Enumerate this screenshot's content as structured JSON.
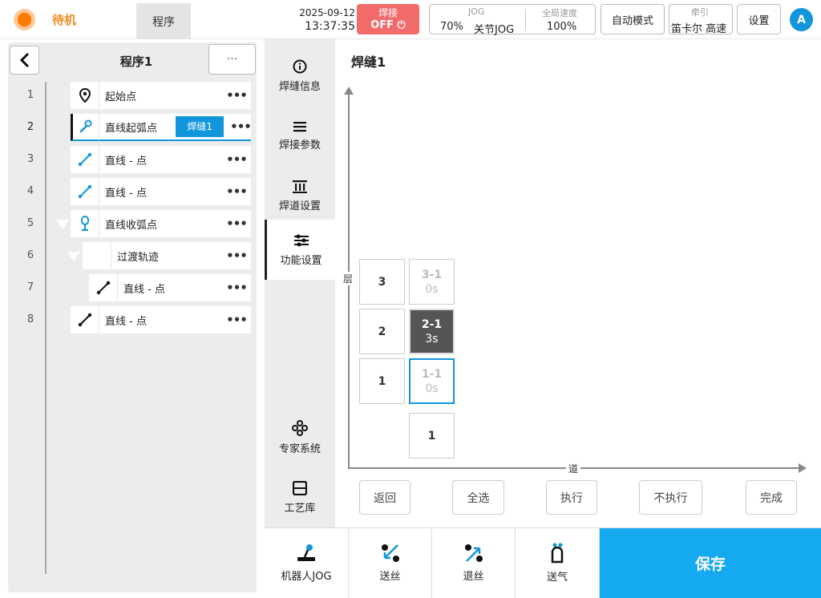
{
  "header": {
    "status": "待机",
    "program_tab": "程序",
    "date": "2025-09-12",
    "time": "13:37:35",
    "weld_label": "焊接",
    "weld_state": "OFF",
    "jog_title": "JOG",
    "jog_percent": "70%",
    "jog_mode": "关节JOG",
    "global_speed_title": "全局速度",
    "global_speed": "100%",
    "auto_mode": "自动模式",
    "traction_title": "牵引",
    "traction_value": "笛卡尔 高速",
    "settings": "设置",
    "avatar": "A"
  },
  "program": {
    "title": "程序1",
    "more": "···",
    "rows": [
      {
        "num": "1",
        "label": "起始点",
        "icon": "location-pin-icon"
      },
      {
        "num": "2",
        "label": "直线起弧点",
        "icon": "weld-torch-icon",
        "tag": "焊缝1"
      },
      {
        "num": "3",
        "label": "直线 - 点",
        "icon": "line-segment-icon"
      },
      {
        "num": "4",
        "label": "直线 - 点",
        "icon": "line-segment-icon"
      },
      {
        "num": "5",
        "label": "直线收弧点",
        "icon": "arc-end-icon"
      },
      {
        "num": "6",
        "label": "过渡轨迹",
        "icon": ""
      },
      {
        "num": "7",
        "label": "直线 - 点",
        "icon": "line-segment-icon"
      },
      {
        "num": "8",
        "label": "直线 - 点",
        "icon": "line-segment-icon"
      }
    ],
    "row_more": "•••"
  },
  "tabs": {
    "weld_info": "焊缝信息",
    "weld_params": "焊接参数",
    "pass_settings": "焊道设置",
    "function_settings": "功能设置",
    "expert_system": "专家系统",
    "process_library": "工艺库"
  },
  "content": {
    "title": "焊缝1",
    "y_axis_label": "层",
    "x_axis_label": "道",
    "layers": [
      "3",
      "2",
      "1"
    ],
    "passes": [
      "1"
    ],
    "cells": [
      {
        "id": "3-1",
        "time": "0s",
        "state": "disabled"
      },
      {
        "id": "2-1",
        "time": "3s",
        "state": "dark"
      },
      {
        "id": "1-1",
        "time": "0s",
        "state": "selected"
      }
    ],
    "buttons": {
      "back": "返回",
      "select_all": "全选",
      "execute": "执行",
      "not_execute": "不执行",
      "done": "完成"
    }
  },
  "bottom": {
    "robot_jog": "机器人JOG",
    "wire_feed": "送丝",
    "wire_retract": "退丝",
    "gas": "送气",
    "save": "保存"
  },
  "colors": {
    "accent": "#15aaf0",
    "weld_off": "#f26b6b",
    "status_orange": "#f08c1e",
    "tag_blue": "#1296db"
  }
}
